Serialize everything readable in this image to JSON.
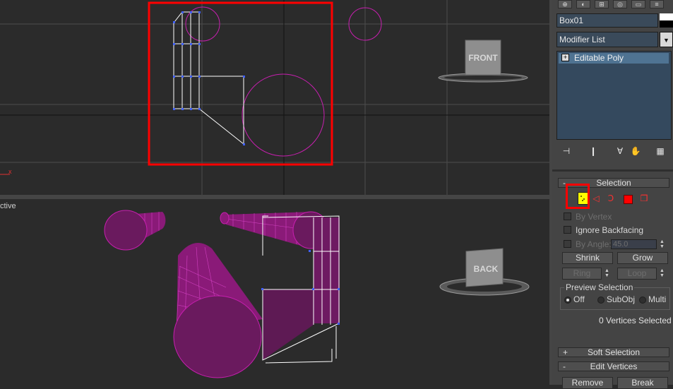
{
  "viewports": {
    "top": {
      "axis_label": "x"
    },
    "bottom": {
      "label": "ctive"
    }
  },
  "viewcube": {
    "top_face": "FRONT",
    "bottom_face": "BACK"
  },
  "command_panel": {
    "tabs": [
      "create",
      "modify",
      "hierarchy",
      "motion",
      "display",
      "utilities"
    ],
    "object_name": "Box01",
    "modifier_list": "Modifier List",
    "stack_item": "Editable Poly",
    "stack_expand": "+",
    "rollouts": {
      "selection": {
        "sign": "-",
        "title": "Selection"
      },
      "soft_selection": {
        "sign": "+",
        "title": "Soft Selection"
      },
      "edit_vertices": {
        "sign": "-",
        "title": "Edit Vertices"
      }
    },
    "by_vertex": "By Vertex",
    "ignore_backfacing": "Ignore Backfacing",
    "by_angle": "By Angle:",
    "angle_value": "45.0",
    "shrink": "Shrink",
    "grow": "Grow",
    "ring": "Ring",
    "loop": "Loop",
    "preview_selection": "Preview Selection",
    "preview_options": [
      "Off",
      "SubObj",
      "Multi"
    ],
    "vertices_selected": "0 Vertices Selected",
    "remove": "Remove",
    "break": "Break"
  },
  "colors": {
    "wire_magenta": "#c81fb0",
    "selection_red": "#ff0000",
    "vertex_blue": "#4060ff",
    "vertex_mode_yellow": "#ffff00"
  }
}
